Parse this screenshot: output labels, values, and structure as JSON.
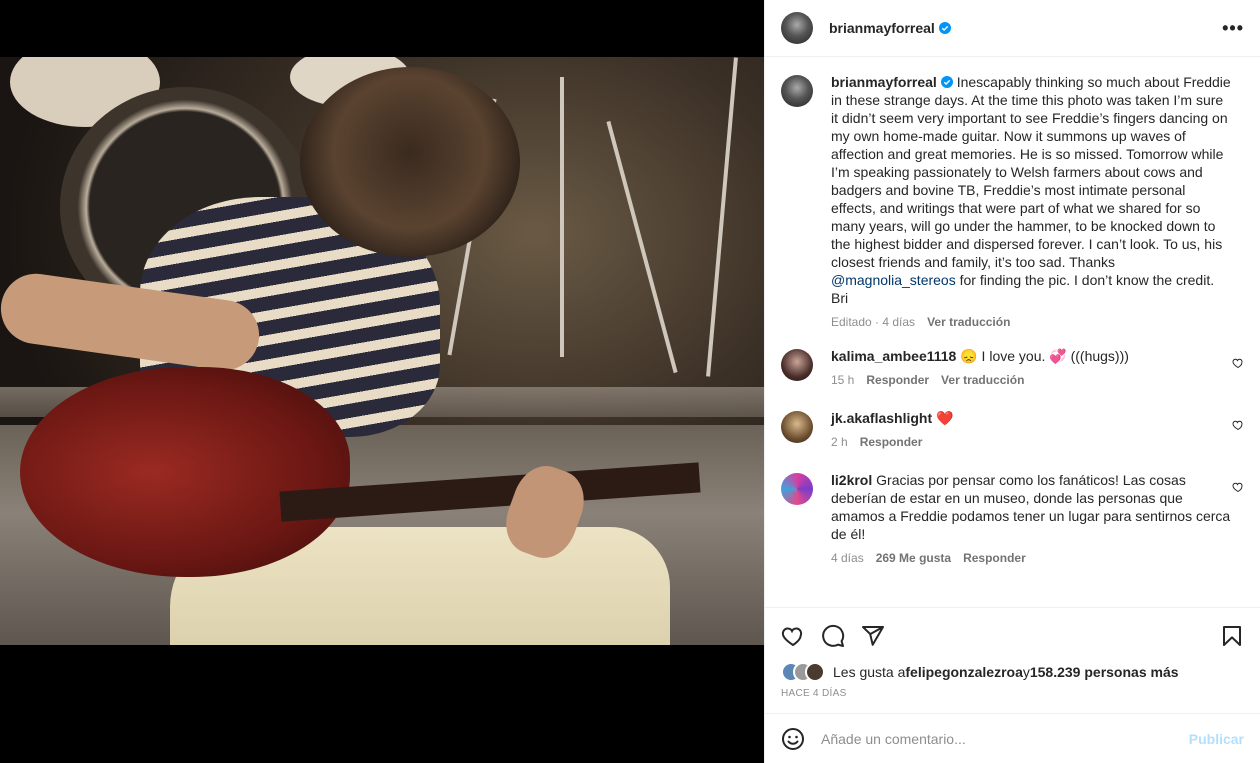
{
  "post": {
    "username": "brianmayforreal",
    "more_label": "•••",
    "accent": "#0095f6",
    "caption": {
      "username": "brianmayforreal",
      "text_before": " Inescapably thinking so much about Freddie in these strange days. At the time this photo was taken I’m sure it didn’t seem very important to see Freddie’s fingers dancing on my own home-made guitar. Now it summons up waves of affection and great memories. He is so missed. Tomorrow while I’m speaking passionately to Welsh farmers about cows and badgers and bovine TB, Freddie’s most intimate personal effects, and writings that were part of what we shared for so many years, will go under the hammer, to be knocked down to the highest bidder and dispersed forever. I can’t look. To us, his closest friends and family, it’s too sad. Thanks ",
      "mention": "@magnolia_stereos",
      "text_after": " for finding the pic. I don’t know the credit. Bri",
      "edited": "Editado · 4 días",
      "translate": "Ver traducción"
    }
  },
  "comments": [
    {
      "username": "kalima_ambee1118",
      "text": " 😞 I love you. 💞 (((hugs)))",
      "time": "15 h",
      "reply": "Responder",
      "translate": "Ver traducción"
    },
    {
      "username": "jk.akaflashlight",
      "text": " ❤️",
      "time": "2 h",
      "reply": "Responder"
    },
    {
      "username": "li2krol",
      "text": " Gracias por pensar como los fanáticos! Las cosas deberían de estar en un museo, donde las personas que amamos a Freddie podamos tener un lugar para sentirnos cerca de él!",
      "time": "4 días",
      "likes": "269 Me gusta",
      "reply": "Responder"
    }
  ],
  "likes": {
    "prefix": "Les gusta a ",
    "user": "felipegonzalezroa",
    "middle": " y ",
    "count": "158.239 personas más"
  },
  "date": "HACE 4 DÍAS",
  "add_comment": {
    "placeholder": "Añade un comentario...",
    "publish": "Publicar"
  },
  "icons": [
    "heart-icon",
    "comment-icon",
    "share-icon",
    "bookmark-icon",
    "emoji-icon",
    "verified-icon",
    "more-icon"
  ]
}
